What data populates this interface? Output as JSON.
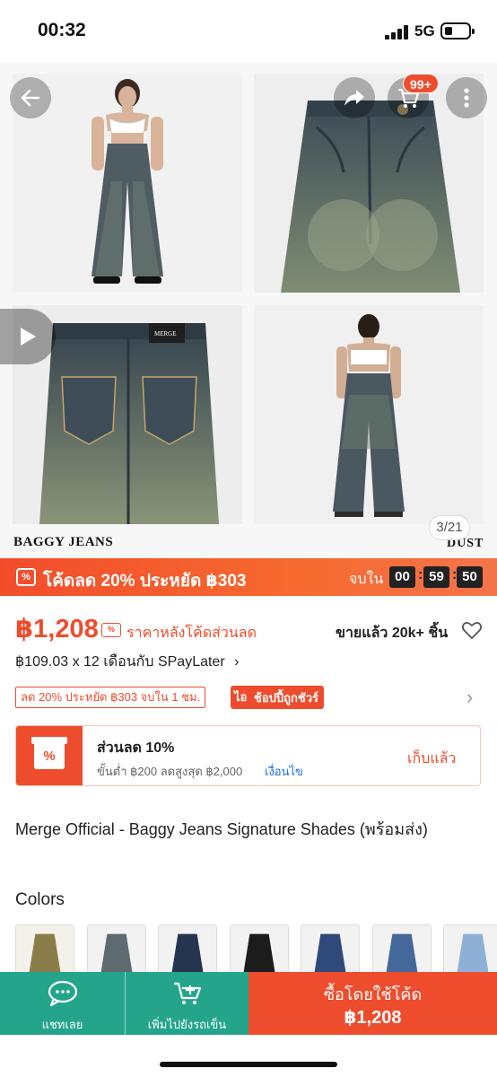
{
  "status_bar": {
    "time": "00:32",
    "network": "5G"
  },
  "gallery": {
    "counter": "3/21",
    "brand_left": "BAGGY JEANS",
    "brand_right": "DUST",
    "tag_text": "MERGE",
    "cart_badge": "99+",
    "icons": [
      "back-arrow-icon",
      "share-icon",
      "cart-icon",
      "more-icon",
      "play-icon"
    ]
  },
  "promo": {
    "icon_text": "%",
    "text": "โค้ดลด 20% ประหยัด ฿303",
    "ends_label": "จบใน",
    "hours": "00",
    "minutes": "59",
    "seconds": "50",
    "colors": {
      "start": "#f24d2b",
      "end": "#f4744a"
    }
  },
  "price": {
    "amount": "฿1,208",
    "note": "ราคาหลังโค้ดส่วนลด",
    "sold": "ขายแล้ว 20k+ ชิ้น",
    "installment": "฿109.03 x 12 เดือนกับ SPayLater",
    "installment_chevron": "›"
  },
  "tags": {
    "discount": "ลด 20% ประหยัด ฿303 จบใน 1 ชม.",
    "guarantee_icon": "ไอ",
    "guarantee": "ช้อปปี้ถูกชัวร์",
    "chevron": "›"
  },
  "voucher": {
    "icon_text": "%",
    "title": "ส่วนลด 10%",
    "condition": "ขั้นต่ำ ฿200 ลดสูงสุด ฿2,000",
    "link": "เงื่อนไข",
    "action": "เก็บแล้ว"
  },
  "product": {
    "title": "Merge Official - Baggy Jeans Signature Shades  (พร้อมส่ง)",
    "colors_label": "Colors"
  },
  "bottom_bar": {
    "chat": "แชทเลย",
    "add_to_cart": "เพิ่มไปยังรถเข็น",
    "buy_label": "ซื้อโดยใช้โค้ด",
    "buy_price": "฿1,208",
    "colors": {
      "teal": "#24a58b",
      "orange": "#ee4d2d"
    }
  }
}
